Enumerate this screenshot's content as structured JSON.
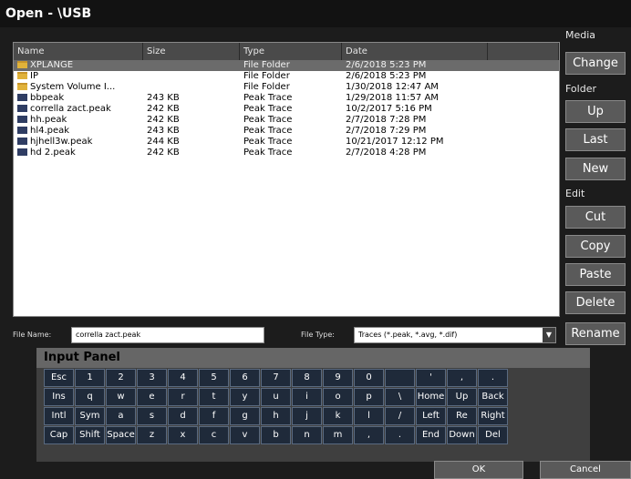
{
  "window": {
    "title": "Open - \\USB"
  },
  "file_list": {
    "columns": [
      "Name",
      "Size",
      "Type",
      "Date"
    ],
    "rows": [
      {
        "icon": "folder",
        "name": "XPLANGE",
        "size": "",
        "type": "File Folder",
        "date": "2/6/2018 5:23 PM",
        "selected": true
      },
      {
        "icon": "folder",
        "name": "IP",
        "size": "",
        "type": "File Folder",
        "date": "2/6/2018 5:23 PM"
      },
      {
        "icon": "folder",
        "name": "System Volume I...",
        "size": "",
        "type": "File Folder",
        "date": "1/30/2018 12:47 AM"
      },
      {
        "icon": "file",
        "name": "bbpeak",
        "size": "243 KB",
        "type": "Peak Trace",
        "date": "1/29/2018 11:57 AM"
      },
      {
        "icon": "file",
        "name": "corrella zact.peak",
        "size": "242 KB",
        "type": "Peak Trace",
        "date": "10/2/2017 5:16 PM"
      },
      {
        "icon": "file",
        "name": "hh.peak",
        "size": "242 KB",
        "type": "Peak Trace",
        "date": "2/7/2018 7:28 PM"
      },
      {
        "icon": "file",
        "name": "hl4.peak",
        "size": "243 KB",
        "type": "Peak Trace",
        "date": "2/7/2018 7:29 PM"
      },
      {
        "icon": "file",
        "name": "hjhell3w.peak",
        "size": "244 KB",
        "type": "Peak Trace",
        "date": "10/21/2017 12:12 PM"
      },
      {
        "icon": "file",
        "name": "hd 2.peak",
        "size": "242 KB",
        "type": "Peak Trace",
        "date": "2/7/2018 4:28 PM"
      }
    ]
  },
  "sidebar": {
    "media_label": "Media",
    "folder_label": "Folder",
    "edit_label": "Edit",
    "buttons": {
      "change": "Change",
      "up": "Up",
      "last": "Last",
      "new": "New",
      "cut": "Cut",
      "copy": "Copy",
      "paste": "Paste",
      "delete": "Delete",
      "rename": "Rename"
    }
  },
  "file_name": {
    "label": "File Name:",
    "value": "corrella zact.peak"
  },
  "file_type": {
    "label": "File Type:",
    "value": "Traces (*.peak, *.avg, *.dif)"
  },
  "input_panel": {
    "title": "Input Panel",
    "rows": [
      [
        "Esc",
        "1",
        "2",
        "3",
        "4",
        "5",
        "6",
        "7",
        "8",
        "9",
        "0",
        "",
        "'",
        ",",
        "."
      ],
      [
        "Ins",
        "q",
        "w",
        "e",
        "r",
        "t",
        "y",
        "u",
        "i",
        "o",
        "p",
        "\\",
        "Home",
        "Up",
        "Back"
      ],
      [
        "Intl",
        "Sym",
        "a",
        "s",
        "d",
        "f",
        "g",
        "h",
        "j",
        "k",
        "l",
        "/",
        "Left",
        "Re",
        "Right"
      ],
      [
        "Cap",
        "Shift",
        "Space",
        "z",
        "x",
        "c",
        "v",
        "b",
        "n",
        "m",
        ",",
        ".",
        "End",
        "Down",
        "Del"
      ]
    ]
  },
  "footer": {
    "ok": "OK",
    "cancel": "Cancel"
  }
}
